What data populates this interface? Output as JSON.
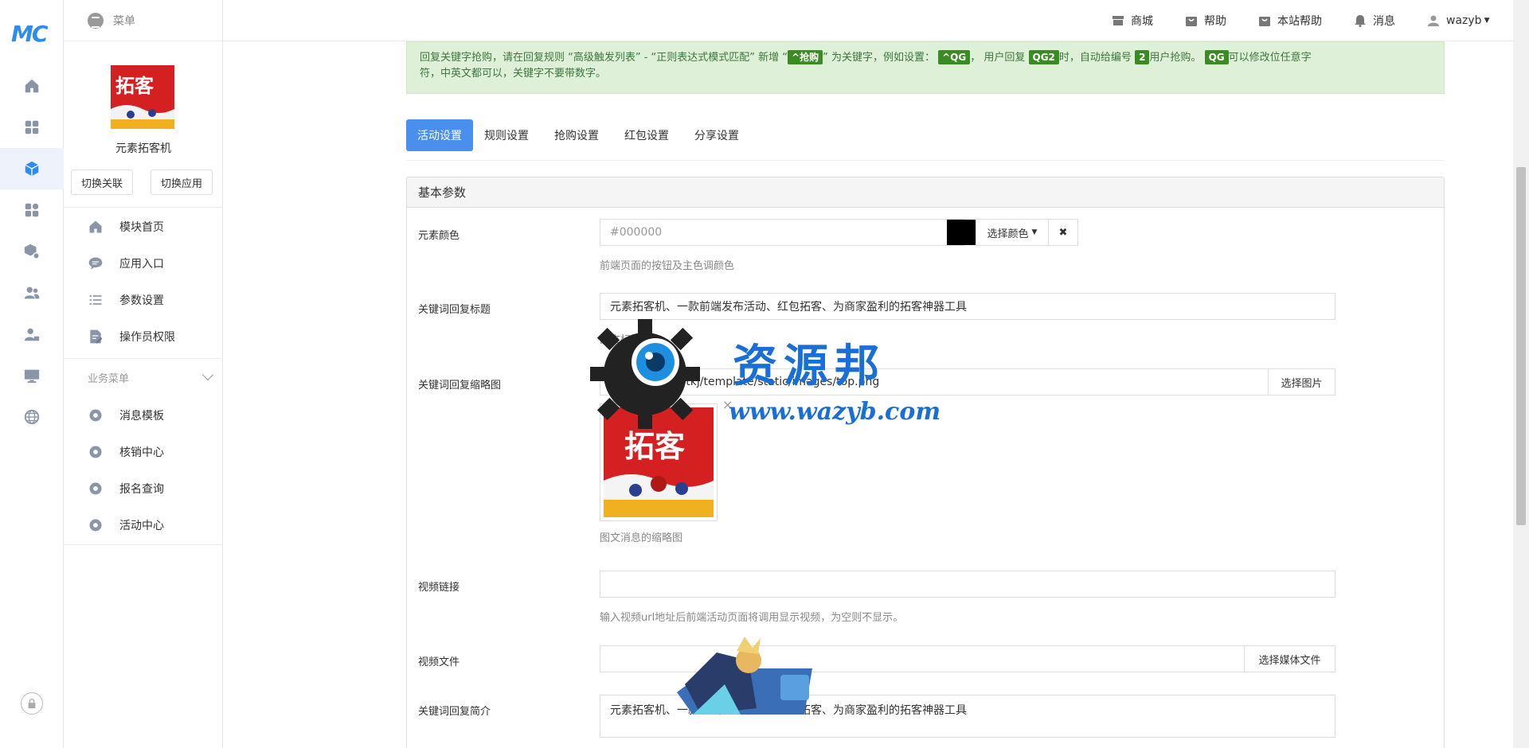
{
  "rail": {
    "logo": "MC"
  },
  "sidebar": {
    "menu_label": "菜单",
    "app_name": "元素拓客机",
    "thumb_text": "拓客",
    "switch_link": "切换关联",
    "switch_app": "切换应用",
    "items": [
      {
        "label": "模块首页",
        "icon": "home-icon"
      },
      {
        "label": "应用入口",
        "icon": "chat-icon"
      },
      {
        "label": "参数设置",
        "icon": "list-icon"
      },
      {
        "label": "操作员权限",
        "icon": "document-edit-icon"
      }
    ],
    "group_label": "业务菜单",
    "group_items": [
      {
        "label": "消息模板"
      },
      {
        "label": "核销中心"
      },
      {
        "label": "报名查询"
      },
      {
        "label": "活动中心"
      }
    ]
  },
  "topbar": {
    "shop": "商城",
    "help": "帮助",
    "site_help": "本站帮助",
    "messages": "消息",
    "user": "wazyb"
  },
  "alert": {
    "p1": "回复关键字抢购，请在回复规则 “高级触发列表” - “正则表达式模式匹配” 新增 “",
    "tag1": "^抢购",
    "p2": "” 为关键字，例如设置：",
    "tag2": "^QG",
    "p3": "， 用户回复",
    "tag3": "QG2",
    "p4": "时，自动给编号",
    "tag4": "2",
    "p5": "用户抢购。",
    "tag5": "QG",
    "p6": "可以修改位任意字",
    "line2": "符，中英文都可以，关键字不要带数字。"
  },
  "tabs": [
    {
      "label": "活动设置",
      "active": true
    },
    {
      "label": "规则设置"
    },
    {
      "label": "抢购设置"
    },
    {
      "label": "红包设置"
    },
    {
      "label": "分享设置"
    }
  ],
  "panel": {
    "title": "基本参数",
    "color": {
      "label": "元素颜色",
      "value": "#000000",
      "select_label": "选择颜色",
      "help": "前端页面的按钮及主色调颜色"
    },
    "reply_title": {
      "label": "关键词回复标题",
      "value": "元素拓客机、一款前端发布活动、红包拓客、为商家盈利的拓客神器工具",
      "help": "图文标题"
    },
    "reply_thumb": {
      "label": "关键词回复缩略图",
      "value": "/addons/ysl_ytkj/template/static/images/top.png",
      "button": "选择图片",
      "help": "图文消息的缩略图"
    },
    "video_link": {
      "label": "视频链接",
      "value": "",
      "help": "输入视频url地址后前端活动页面将调用显示视频，为空则不显示。"
    },
    "video_file": {
      "label": "视频文件",
      "value": "",
      "button": "选择媒体文件"
    },
    "reply_desc": {
      "label": "关键词回复简介",
      "value": "元素拓客机、一款前端发布活动、红包拓客、为商家盈利的拓客神器工具"
    }
  },
  "watermark": {
    "title": "资源邦",
    "url": "www.wazyb.com"
  },
  "colors": {
    "accent": "#4a8fed",
    "alert_bg": "#dff0d8",
    "tag_bg": "#3a8b24"
  }
}
